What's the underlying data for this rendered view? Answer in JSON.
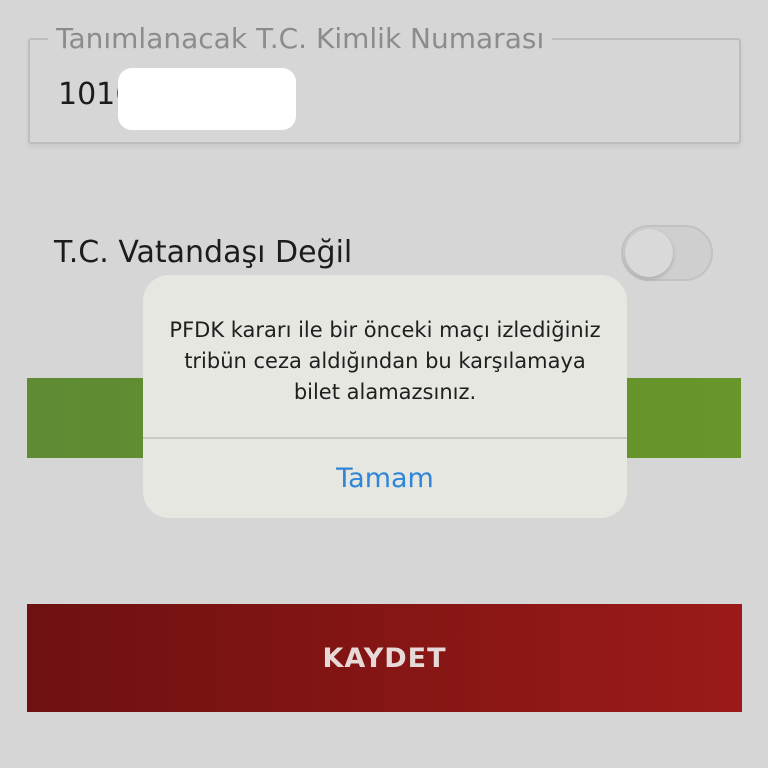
{
  "form": {
    "tc_field": {
      "label": "Tanımlanacak T.C. Kimlik Numarası",
      "value": "1016"
    },
    "non_citizen_toggle": {
      "label": "T.C. Vatandaşı Değil",
      "on": false
    },
    "save_label": "KAYDET"
  },
  "alert": {
    "message": "PFDK kararı ile bir önceki maçı izlediğiniz tribün ceza aldığından bu karşılamaya bilet alamazsınız.",
    "action_label": "Tamam"
  },
  "colors": {
    "background": "#d6d6d6",
    "accent_green": "#62902f",
    "save_red": "#8a1716",
    "alert_action_blue": "#2f86d8"
  }
}
